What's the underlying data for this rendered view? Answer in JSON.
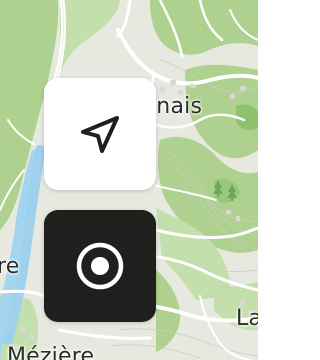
{
  "map": {
    "labels": {
      "top": "inais",
      "left": "re",
      "right": "La",
      "bottom": "Mézière"
    },
    "colors": {
      "land": "#e8eae1",
      "forest": "#a9cf8b",
      "forest_light": "#c5e0ad",
      "water": "#9ed3f0",
      "road": "#ffffff"
    }
  },
  "controls": {
    "navigate_button": {
      "icon": "navigation-arrow-icon",
      "background": "#ffffff"
    },
    "locate_button": {
      "icon": "target-icon",
      "background": "#1f1f1d"
    }
  }
}
